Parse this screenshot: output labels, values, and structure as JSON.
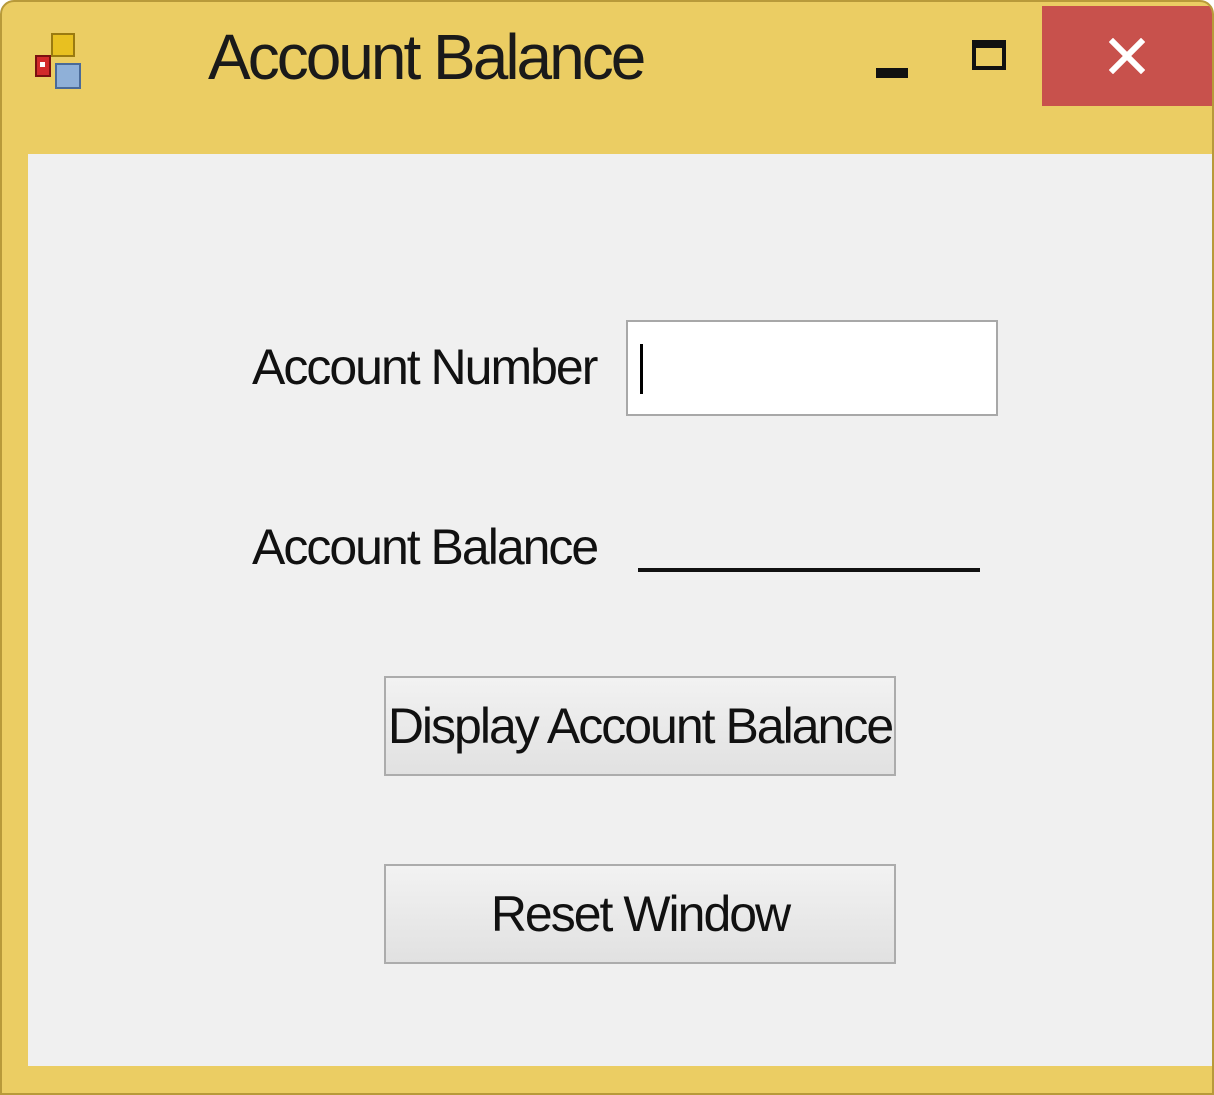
{
  "window": {
    "title": "Account Balance",
    "title_bar_color": "#ebcd63",
    "close_button_color": "#c8514c",
    "icon": "windows-form-icon",
    "controls": {
      "minimize_icon": "minimize-icon",
      "maximize_icon": "maximize-icon",
      "close_icon": "close-icon"
    }
  },
  "form": {
    "account_number_label": "Account Number",
    "account_number_value": "",
    "account_balance_label": "Account Balance",
    "account_balance_value": "",
    "display_button_label": "Display Account Balance",
    "reset_button_label": "Reset Window"
  }
}
